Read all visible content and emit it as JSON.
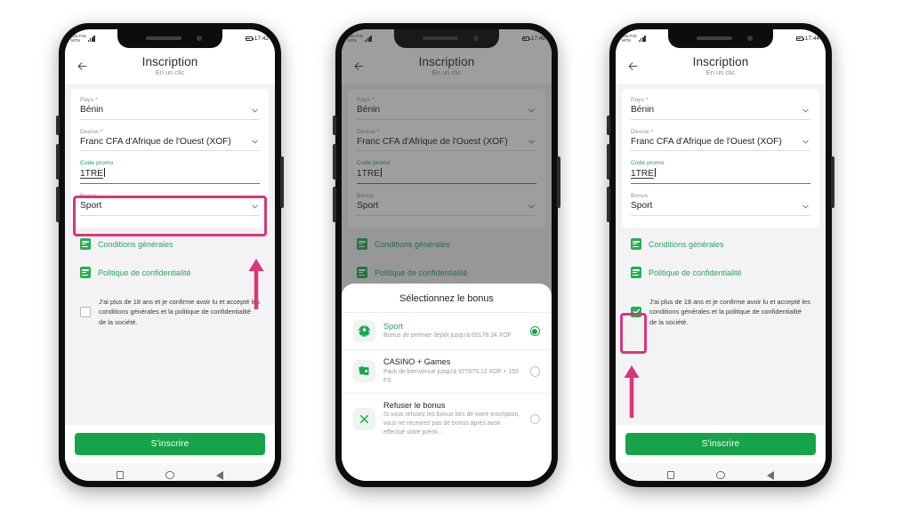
{
  "app": {
    "title": "Inscription",
    "subtitle": "En un clic",
    "back_icon": "back-arrow-icon"
  },
  "status_bar": {
    "carrier_line1": "CELTIIS",
    "carrier_line2": "MTN",
    "times": [
      "17:42",
      "17:49",
      "17:44"
    ]
  },
  "form": {
    "country": {
      "label": "Pays *",
      "value": "Bénin"
    },
    "currency": {
      "label": "Devise *",
      "value": "Franc CFA d'Afrique de l'Ouest (XOF)"
    },
    "promo": {
      "label": "Code promo",
      "value": "1TRE"
    },
    "bonus": {
      "label": "Bonus",
      "value": "Sport"
    }
  },
  "links": {
    "terms": "Conditions générales",
    "privacy": "Politique de confidentialité"
  },
  "consent": {
    "text": "J'ai plus de 18 ans et je confirme avoir lu et accepté les conditions générales et la politique de confidentialité de la société."
  },
  "cta": {
    "label": "S'inscrire"
  },
  "nav": {
    "recents": "square-icon",
    "home": "circle-icon",
    "back": "triangle-back-icon"
  },
  "sheet": {
    "title": "Sélectionnez le bonus",
    "options": [
      {
        "name": "Sport",
        "desc": "Bonus de premier dépôt jusqu'à 65178.34 XOF",
        "icon": "soccer-ball-icon",
        "selected": true
      },
      {
        "name": "CASINO + Games",
        "desc": "Pack de bienvenue jusqu'à 977675.12 XOF + 150 FS",
        "icon": "playing-cards-icon",
        "selected": false
      },
      {
        "name": "Refuser le bonus",
        "desc": "Si vous refusez les bonus lors de votre inscription, vous ne recevrez pas de bonus après avoir effectué votre premi...",
        "icon": "close-x-icon",
        "selected": false
      }
    ]
  },
  "annotations": {
    "highlight_color": "#de3479",
    "step1_target": "bonus-field",
    "step3_target": "consent-checkbox"
  },
  "colors": {
    "brand_green": "#16a34a",
    "link_green": "#2aa558",
    "pink": "#de3479",
    "page_bg": "#f3f3f6"
  }
}
